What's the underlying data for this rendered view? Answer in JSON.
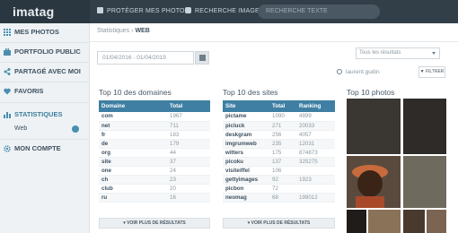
{
  "header": {
    "logo": "imatag",
    "nav": [
      {
        "label": "PROTÉGER MES PHOTOS",
        "icon": "lock-icon"
      },
      {
        "label": "RECHERCHE IMAGE",
        "icon": "camera-icon"
      }
    ],
    "search_placeholder": "RECHERCHE TEXTE"
  },
  "sidebar": {
    "items": [
      {
        "label": "MES PHOTOS",
        "icon": "grid-icon"
      },
      {
        "label": "PORTFOLIO PUBLIC",
        "icon": "portfolio-icon"
      },
      {
        "label": "PARTAGÉ AVEC MOI",
        "icon": "share-icon"
      },
      {
        "label": "FAVORIS",
        "icon": "heart-icon"
      },
      {
        "label": "STATISTIQUES",
        "icon": "chart-icon"
      },
      {
        "label": "MON COMPTE",
        "icon": "gear-icon"
      }
    ],
    "sub_item": "Web"
  },
  "breadcrumb": {
    "parent": "Statistiques",
    "separator": "›",
    "current": "WEB"
  },
  "date_range": "01/04/2016 - 01/04/2019",
  "filters": {
    "select": "Tous les résultats",
    "user": "laurent gudin",
    "button": "FILTRER"
  },
  "domains": {
    "title": "Top 10 des domaines",
    "headers": [
      "Domaine",
      "Total"
    ],
    "rows": [
      [
        "com",
        "1967"
      ],
      [
        "net",
        "711"
      ],
      [
        "fr",
        "183"
      ],
      [
        "de",
        "179"
      ],
      [
        "org",
        "44"
      ],
      [
        "site",
        "37"
      ],
      [
        "one",
        "24"
      ],
      [
        "ch",
        "23"
      ],
      [
        "club",
        "20"
      ],
      [
        "ru",
        "16"
      ]
    ],
    "more": "VOIR PLUS DE RÉSULTATS"
  },
  "sites": {
    "title": "Top 10 des sites",
    "headers": [
      "Site",
      "Total",
      "Ranking"
    ],
    "rows": [
      [
        "pictame",
        "1090",
        "4899"
      ],
      [
        "picluck",
        "271",
        "20033"
      ],
      [
        "deskgram",
        "256",
        "4057"
      ],
      [
        "imgrumweb",
        "235",
        "12031"
      ],
      [
        "witters",
        "175",
        "874873"
      ],
      [
        "picoku",
        "137",
        "325275"
      ],
      [
        "visiteiffel",
        "106",
        ""
      ],
      [
        "gettyimages",
        "92",
        "1923"
      ],
      [
        "picbon",
        "72",
        ""
      ],
      [
        "neomag",
        "68",
        "199012"
      ]
    ],
    "more": "VOIR PLUS DE RÉSULTATS"
  },
  "photos": {
    "title": "Top 10 photos",
    "colors": [
      "#3a3632",
      "#2e2b28",
      "#5a4a3e",
      "#6e6a5e",
      "#1f1c1a",
      "#8a7258",
      "#4a3a2e",
      "#7c6452"
    ]
  }
}
